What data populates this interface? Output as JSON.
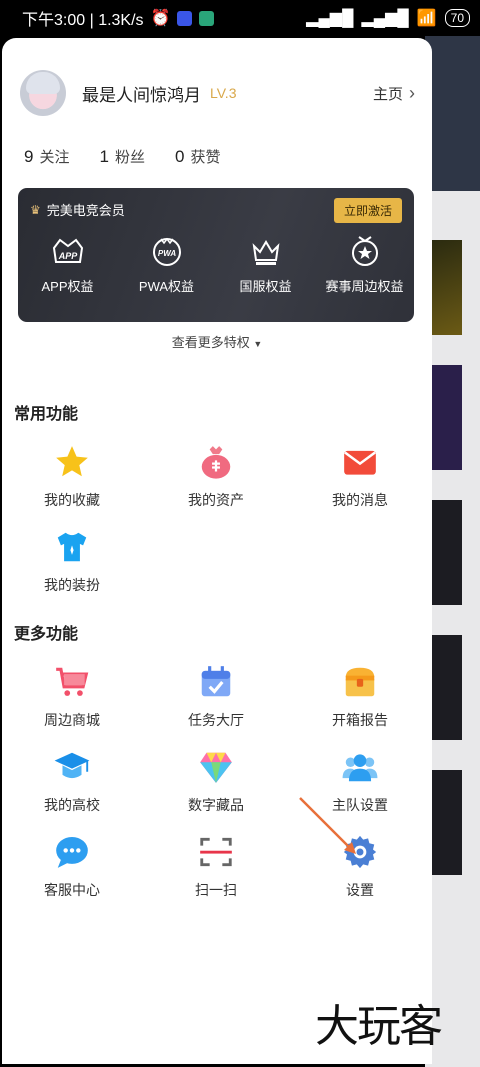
{
  "status_bar": {
    "time_speed": "下午3:00 | 1.3K/s",
    "battery": "70"
  },
  "profile": {
    "username": "最是人间惊鸿月",
    "level": "LV.3",
    "home_label": "主页"
  },
  "stats": [
    {
      "count": "9",
      "label": "关注"
    },
    {
      "count": "1",
      "label": "粉丝"
    },
    {
      "count": "0",
      "label": "获赞"
    }
  ],
  "vip": {
    "title": "完美电竞会员",
    "activate_label": "立即激活",
    "items": [
      {
        "label": "APP权益",
        "icon": "app-crown-icon"
      },
      {
        "label": "PWA权益",
        "icon": "pwa-crown-icon"
      },
      {
        "label": "国服权益",
        "icon": "crown-icon"
      },
      {
        "label": "赛事周边权益",
        "icon": "medal-icon"
      }
    ],
    "more_label": "查看更多特权"
  },
  "common": {
    "title": "常用功能",
    "items": [
      {
        "label": "我的收藏",
        "icon": "star-icon"
      },
      {
        "label": "我的资产",
        "icon": "money-bag-icon"
      },
      {
        "label": "我的消息",
        "icon": "mail-icon"
      },
      {
        "label": "我的装扮",
        "icon": "tshirt-icon"
      }
    ]
  },
  "more": {
    "title": "更多功能",
    "items": [
      {
        "label": "周边商城",
        "icon": "cart-icon"
      },
      {
        "label": "任务大厅",
        "icon": "calendar-check-icon"
      },
      {
        "label": "开箱报告",
        "icon": "chest-icon"
      },
      {
        "label": "我的高校",
        "icon": "graduation-cap-icon"
      },
      {
        "label": "数字藏品",
        "icon": "diamond-icon"
      },
      {
        "label": "主队设置",
        "icon": "team-icon"
      },
      {
        "label": "客服中心",
        "icon": "chat-bubble-icon"
      },
      {
        "label": "扫一扫",
        "icon": "scan-icon"
      },
      {
        "label": "设置",
        "icon": "gear-icon"
      }
    ]
  },
  "watermark": "大玩客",
  "colors": {
    "accent": "#e7b647",
    "level": "#d9a84a",
    "vip_bg": "#2a2c33"
  }
}
